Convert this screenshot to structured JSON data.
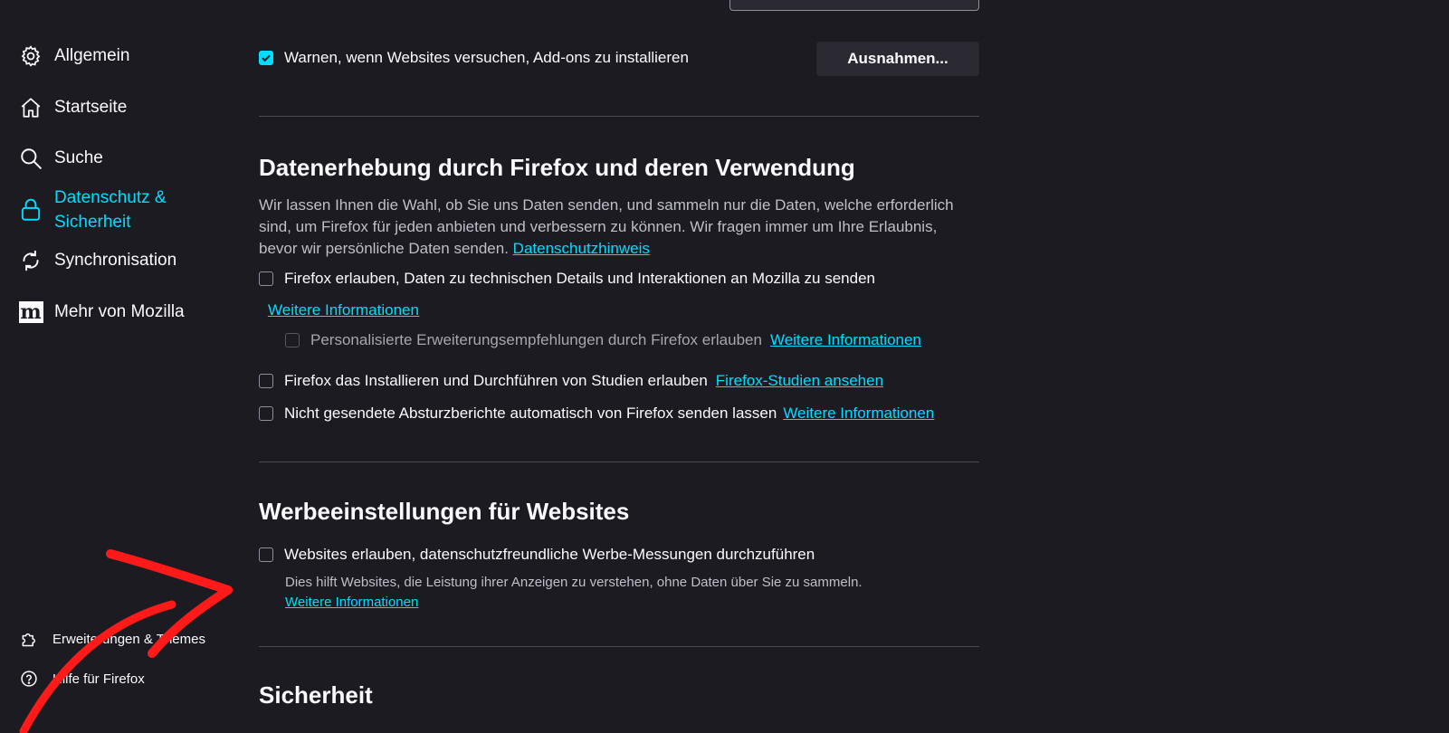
{
  "sidebar": {
    "items": [
      {
        "label": "Allgemein",
        "icon": "gear-icon"
      },
      {
        "label": "Startseite",
        "icon": "home-icon"
      },
      {
        "label": "Suche",
        "icon": "search-icon"
      },
      {
        "label_line1": "Datenschutz &",
        "label_line2": "Sicherheit",
        "icon": "lock-icon",
        "selected": true
      },
      {
        "label": "Synchronisation",
        "icon": "sync-icon"
      },
      {
        "label": "Mehr von Mozilla",
        "icon": "mozilla-icon",
        "icon_text": "m"
      }
    ],
    "footer": [
      {
        "label": "Erweiterungen & Themes",
        "icon": "puzzle-icon"
      },
      {
        "label": "Hilfe für Firefox",
        "icon": "help-icon"
      }
    ]
  },
  "addons": {
    "warn_label": "Warnen, wenn Websites versuchen, Add-ons zu installieren",
    "warn_checked": true,
    "exceptions_button": "Ausnahmen..."
  },
  "data_collection": {
    "heading": "Datenerhebung durch Firefox und deren Verwendung",
    "description": "Wir lassen Ihnen die Wahl, ob Sie uns Daten senden, und sammeln nur die Daten, welche erforderlich sind, um Firefox für jeden anbieten und verbessern zu können. Wir fragen immer um Ihre Erlaubnis, bevor wir persönliche Daten senden.",
    "privacy_link": "Datenschutzhinweis",
    "technical_label": "Firefox erlauben, Daten zu technischen Details und Interaktionen an Mozilla zu senden",
    "technical_more": "Weitere Informationen",
    "personalized_label": "Personalisierte Erweiterungsempfehlungen durch Firefox erlauben",
    "personalized_more": "Weitere Informationen",
    "studies_label": "Firefox das Installieren und Durchführen von Studien erlauben",
    "studies_link": "Firefox-Studien ansehen",
    "crash_label": "Nicht gesendete Absturzberichte automatisch von Firefox senden lassen",
    "crash_more": "Weitere Informationen"
  },
  "ads": {
    "heading": "Werbeeinstellungen für Websites",
    "measure_label": "Websites erlauben, datenschutzfreundliche Werbe-Messungen durchzuführen",
    "measure_description": "Dies hilft Websites, die Leistung ihrer Anzeigen zu verstehen, ohne Daten über Sie zu sammeln.",
    "measure_more": "Weitere Informationen"
  },
  "security": {
    "heading": "Sicherheit"
  },
  "colors": {
    "background": "#1c1b22",
    "accent": "#00ddff",
    "annotation_arrow": "#ff1a1a"
  }
}
